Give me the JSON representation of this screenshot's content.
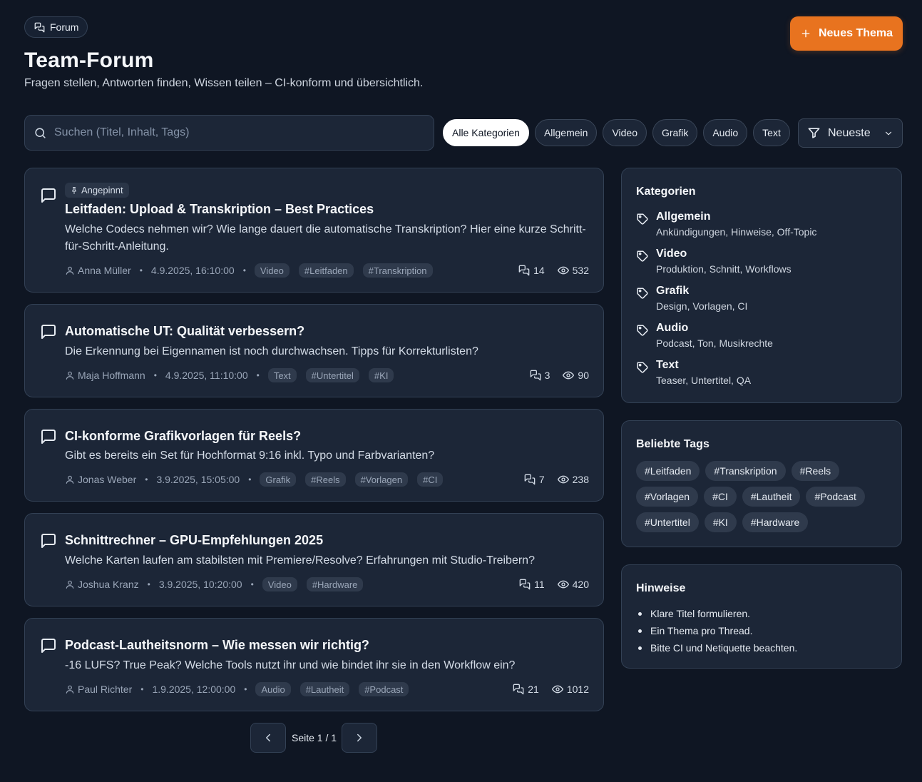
{
  "header": {
    "breadcrumb": "Forum",
    "title": "Team-Forum",
    "subtitle": "Fragen stellen, Antworten finden, Wissen teilen – CI-konform und übersichtlich.",
    "new_button": "Neues Thema"
  },
  "colors": {
    "accent": "#e8731f",
    "background": "#0f1623",
    "card": "#1c2637"
  },
  "search": {
    "placeholder": "Suchen (Titel, Inhalt, Tags)",
    "value": ""
  },
  "filters": [
    "Alle Kategorien",
    "Allgemein",
    "Video",
    "Grafik",
    "Audio",
    "Text"
  ],
  "active_filter": "Alle Kategorien",
  "sort": {
    "selected": "Neueste"
  },
  "posts": [
    {
      "pinned": true,
      "pin_label": "Angepinnt",
      "title": "Leitfaden: Upload & Transkription – Best Practices",
      "excerpt": "Welche Codecs nehmen wir? Wie lange dauert die automatische Transkription? Hier eine kurze Schritt-für-Schritt-Anleitung.",
      "author": "Anna Müller",
      "date": "4.9.2025, 16:10:00",
      "category": "Video",
      "tags": [
        "#Leitfaden",
        "#Transkription"
      ],
      "replies": "14",
      "views": "532"
    },
    {
      "pinned": false,
      "title": "Automatische UT: Qualität verbessern?",
      "excerpt": "Die Erkennung bei Eigennamen ist noch durchwachsen. Tipps für Korrekturlisten?",
      "author": "Maja Hoffmann",
      "date": "4.9.2025, 11:10:00",
      "category": "Text",
      "tags": [
        "#Untertitel",
        "#KI"
      ],
      "replies": "3",
      "views": "90"
    },
    {
      "pinned": false,
      "title": "CI-konforme Grafikvorlagen für Reels?",
      "excerpt": "Gibt es bereits ein Set für Hochformat 9:16 inkl. Typo und Farbvarianten?",
      "author": "Jonas Weber",
      "date": "3.9.2025, 15:05:00",
      "category": "Grafik",
      "tags": [
        "#Reels",
        "#Vorlagen",
        "#CI"
      ],
      "replies": "7",
      "views": "238"
    },
    {
      "pinned": false,
      "title": "Schnittrechner – GPU-Empfehlungen 2025",
      "excerpt": "Welche Karten laufen am stabilsten mit Premiere/Resolve? Erfahrungen mit Studio-Treibern?",
      "author": "Joshua Kranz",
      "date": "3.9.2025, 10:20:00",
      "category": "Video",
      "tags": [
        "#Hardware"
      ],
      "replies": "11",
      "views": "420"
    },
    {
      "pinned": false,
      "title": "Podcast-Lautheitsnorm – Wie messen wir richtig?",
      "excerpt": "-16 LUFS? True Peak? Welche Tools nutzt ihr und wie bindet ihr sie in den Workflow ein?",
      "author": "Paul Richter",
      "date": "1.9.2025, 12:00:00",
      "category": "Audio",
      "tags": [
        "#Lautheit",
        "#Podcast"
      ],
      "replies": "21",
      "views": "1012"
    }
  ],
  "pagination": {
    "label": "Seite 1 / 1"
  },
  "sidebar": {
    "categories_title": "Kategorien",
    "categories": [
      {
        "name": "Allgemein",
        "desc": "Ankündigungen, Hinweise, Off-Topic"
      },
      {
        "name": "Video",
        "desc": "Produktion, Schnitt, Workflows"
      },
      {
        "name": "Grafik",
        "desc": "Design, Vorlagen, CI"
      },
      {
        "name": "Audio",
        "desc": "Podcast, Ton, Musikrechte"
      },
      {
        "name": "Text",
        "desc": "Teaser, Untertitel, QA"
      }
    ],
    "tags_title": "Beliebte Tags",
    "popular_tags": [
      "#Leitfaden",
      "#Transkription",
      "#Reels",
      "#Vorlagen",
      "#CI",
      "#Lautheit",
      "#Podcast",
      "#Untertitel",
      "#KI",
      "#Hardware"
    ],
    "hints_title": "Hinweise",
    "hints": [
      "Klare Titel formulieren.",
      "Ein Thema pro Thread.",
      "Bitte CI und Netiquette beachten."
    ]
  }
}
